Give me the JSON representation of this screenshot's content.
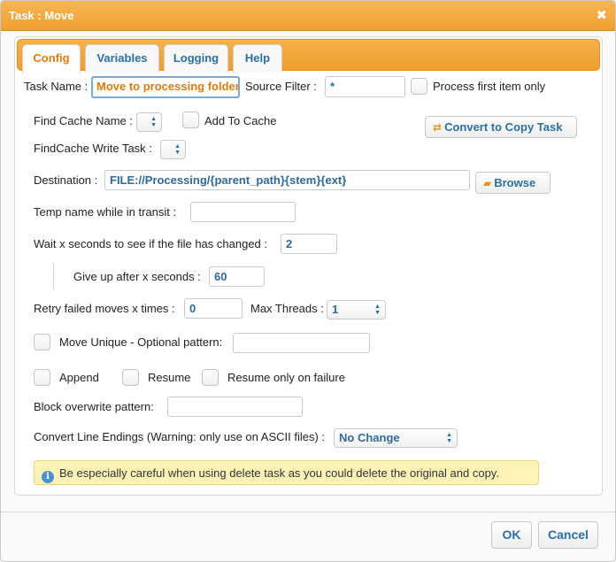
{
  "window": {
    "title": "Task : Move",
    "close_glyph": "✖"
  },
  "tabs": [
    {
      "label": "Config",
      "active": true
    },
    {
      "label": "Variables",
      "active": false
    },
    {
      "label": "Logging",
      "active": false
    },
    {
      "label": "Help",
      "active": false
    }
  ],
  "task_name": {
    "label": "Task Name :",
    "value": "Move to processing folder"
  },
  "source_filter": {
    "label": "Source Filter :",
    "value": "*"
  },
  "process_first": {
    "label": "Process first item only",
    "checked": false
  },
  "find_cache": {
    "label": "Find Cache Name :",
    "value": ""
  },
  "add_to_cache": {
    "label": "Add To Cache",
    "checked": false
  },
  "convert_button": {
    "label": "Convert to Copy Task",
    "icon": "swap-arrows-icon"
  },
  "findcache_write": {
    "label": "FindCache Write Task :",
    "value": ""
  },
  "destination": {
    "label": "Destination :",
    "value": "FILE://Processing/{parent_path}{stem}{ext}"
  },
  "browse_button": {
    "label": "Browse",
    "icon": "folder-open-icon"
  },
  "temp_name": {
    "label": "Temp name while in transit :",
    "value": ""
  },
  "wait_seconds": {
    "label": "Wait x seconds to see if the file has changed :",
    "value": "2"
  },
  "give_up": {
    "label": "Give up after x seconds :",
    "value": "60"
  },
  "retry": {
    "label": "Retry failed moves x times :",
    "value": "0"
  },
  "max_threads": {
    "label": "Max Threads :",
    "value": "1"
  },
  "move_unique": {
    "label": "Move Unique - Optional pattern:",
    "checked": false,
    "value": ""
  },
  "append": {
    "label": "Append",
    "checked": false
  },
  "resume": {
    "label": "Resume",
    "checked": false
  },
  "resume_failure": {
    "label": "Resume only on failure",
    "checked": false
  },
  "block_overwrite": {
    "label": "Block overwrite pattern:",
    "value": ""
  },
  "line_endings": {
    "label": "Convert Line Endings (Warning: only use on ASCII files) :",
    "value": "No Change"
  },
  "notice": {
    "text": "Be especially careful when using delete task as you could delete the original and copy.",
    "icon_glyph": "i"
  },
  "footer": {
    "ok_label": "OK",
    "cancel_label": "Cancel"
  },
  "colors": {
    "accent": "#f0a030",
    "link": "#2a6fa8",
    "active_tab": "#e07c0c",
    "notice_bg": "#fdf3b6"
  }
}
